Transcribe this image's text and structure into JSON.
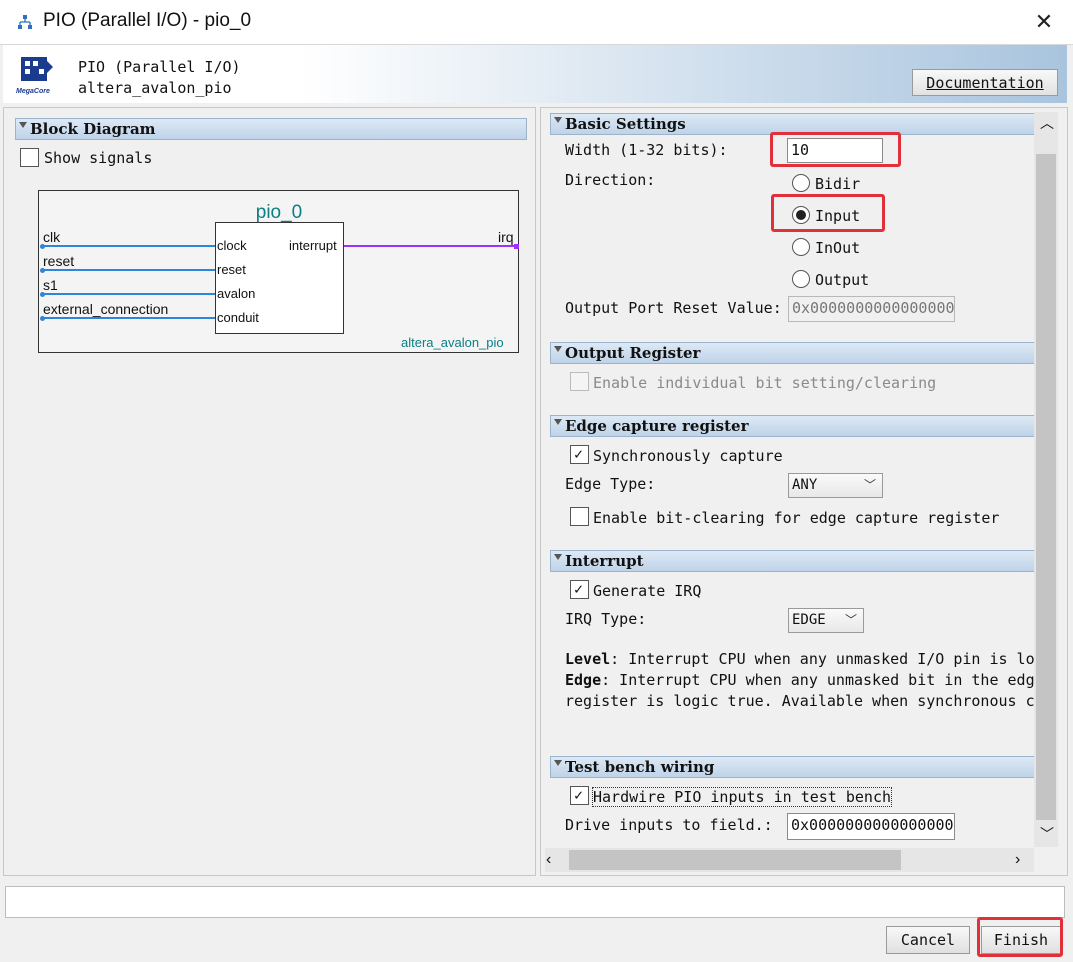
{
  "window": {
    "title": "PIO (Parallel I/O) - pio_0"
  },
  "header": {
    "title": "PIO (Parallel I/O)",
    "subtitle": "altera_avalon_pio",
    "logo_text": "MegaCore",
    "doc_button": "Documentation"
  },
  "block_diagram": {
    "section": "Block Diagram",
    "show_signals": "Show signals",
    "instance_name": "pio_0",
    "component_name": "altera_avalon_pio",
    "left_signals": [
      "clk",
      "reset",
      "s1",
      "external_connection"
    ],
    "ports_left": [
      "clock",
      "reset",
      "avalon",
      "conduit"
    ],
    "port_right": "interrupt",
    "right_signal": "irq"
  },
  "basic_settings": {
    "section": "Basic Settings",
    "width_label": "Width (1-32 bits):",
    "width_value": "10",
    "direction_label": "Direction:",
    "directions": [
      "Bidir",
      "Input",
      "InOut",
      "Output"
    ],
    "selected_direction": "Input",
    "reset_label": "Output Port Reset Value:",
    "reset_value": "0x0000000000000000"
  },
  "output_register": {
    "section": "Output Register",
    "enable_label": "Enable individual bit setting/clearing"
  },
  "edge_capture": {
    "section": "Edge capture register",
    "sync_label": "Synchronously capture",
    "edge_type_label": "Edge Type:",
    "edge_type_value": "ANY",
    "bitclear_label": "Enable bit-clearing for edge capture register"
  },
  "interrupt": {
    "section": "Interrupt",
    "gen_irq_label": "Generate IRQ",
    "irq_type_label": "IRQ Type:",
    "irq_type_value": "EDGE",
    "level_term": "Level",
    "level_text": ": Interrupt CPU when any unmasked I/O pin is lo",
    "edge_term": "Edge",
    "edge_text": ": Interrupt CPU when any unmasked bit in the edg",
    "edge_text2": "register is logic true. Available when synchronous c"
  },
  "testbench": {
    "section": "Test bench wiring",
    "hardwire_label": "Hardwire PIO inputs in test bench",
    "drive_label": "Drive inputs to field.:",
    "drive_value": "0x0000000000000000"
  },
  "buttons": {
    "cancel": "Cancel",
    "finish": "Finish"
  },
  "colors": {
    "highlight_red": "#e0313b",
    "signal_blue": "#2f86d8",
    "irq_purple": "#9b30ff",
    "title_teal": "#0a7f86"
  }
}
